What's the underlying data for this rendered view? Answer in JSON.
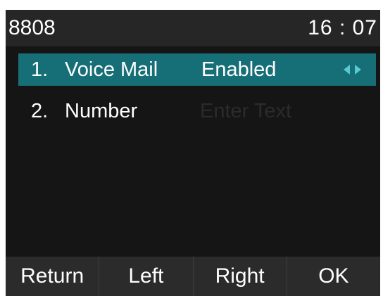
{
  "statusbar": {
    "account": "8808",
    "time": "16 : 07"
  },
  "menu": {
    "items": [
      {
        "index": "1.",
        "label": "Voice Mail",
        "value": "Enabled",
        "selected": true
      },
      {
        "index": "2.",
        "label": "Number",
        "value": "",
        "placeholder": "Enter Text",
        "selected": false
      }
    ]
  },
  "softkeys": {
    "return_label": "Return",
    "left_label": "Left",
    "right_label": "Right",
    "ok_label": "OK"
  },
  "icons": {
    "switch": "left-right-arrows-icon"
  },
  "colors": {
    "background": "#151515",
    "statusbar": "#262626",
    "selection": "#166e76",
    "arrows": "#56c9d6",
    "softkey_bar": "#2b2b2b",
    "placeholder": "#2b2b2b"
  }
}
